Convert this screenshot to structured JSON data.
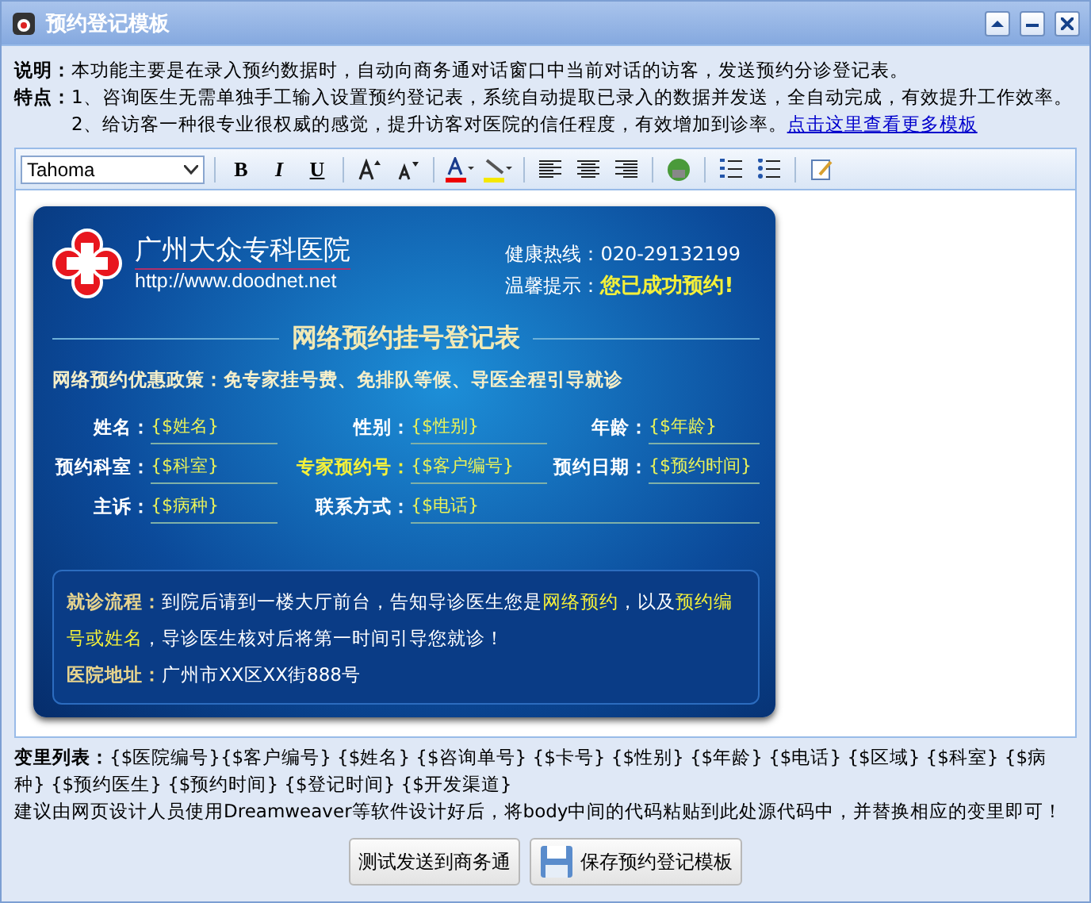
{
  "window": {
    "title": "预约登记模板"
  },
  "info": {
    "description_label": "说明：",
    "description": "本功能主要是在录入预约数据时，自动向商务通对话窗口中当前对话的访客，发送预约分诊登记表。",
    "features_label": "特点：",
    "features": [
      "1、咨询医生无需单独手工输入设置预约登记表，系统自动提取已录入的数据并发送，全自动完成，有效提升工作效率。",
      "2、给访客一种很专业很权威的感觉，提升访客对医院的信任程度，有效增加到诊率。"
    ],
    "link": "点击这里查看更多模板"
  },
  "editor": {
    "font": "Tahoma",
    "format_buttons": [
      "B",
      "I",
      "U"
    ]
  },
  "card": {
    "hospital_name": "广州大众专科医院",
    "url": "http://www.doodnet.net",
    "hotline_label": "健康热线：",
    "hotline": "020-29132199",
    "tip_label": "温馨提示：",
    "tip": "您已成功预约!",
    "form_title": "网络预约挂号登记表",
    "policy": "网络预约优惠政策：免专家挂号费、免排队等候、导医全程引导就诊",
    "fields": [
      {
        "label": "姓名：",
        "value": "{$姓名}",
        "highlight": false,
        "wide": false
      },
      {
        "label": "性别：",
        "value": "{$性别}",
        "highlight": false,
        "wide": false
      },
      {
        "label": "年龄：",
        "value": "{$年龄}",
        "highlight": false,
        "wide": false
      },
      {
        "label": "预约科室：",
        "value": "{$科室}",
        "highlight": false,
        "wide": false
      },
      {
        "label": "专家预约号：",
        "value": "{$客户编号}",
        "highlight": true,
        "wide": false
      },
      {
        "label": "预约日期：",
        "value": "{$预约时间}",
        "highlight": false,
        "wide": false
      },
      {
        "label": "主诉：",
        "value": "{$病种}",
        "highlight": false,
        "wide": false
      },
      {
        "label": "联系方式：",
        "value": "{$电话}",
        "highlight": false,
        "wide": true
      }
    ],
    "process_label": "就诊流程：",
    "process": [
      {
        "text": "到院后请到一楼大厅前台，告知导诊医生您是",
        "highlight": false
      },
      {
        "text": "网络预约",
        "highlight": true
      },
      {
        "text": "，以及",
        "highlight": false
      },
      {
        "text": "预约编号或姓名",
        "highlight": true
      },
      {
        "text": "，导诊医生核对后将第一时间引导您就诊！",
        "highlight": false
      }
    ],
    "address_label": "医院地址：",
    "address": "广州市XX区XX街888号"
  },
  "variables": {
    "label": "变里列表：",
    "list": "{$医院编号}{$客户编号} {$姓名} {$咨询单号} {$卡号} {$性别} {$年龄} {$电话} {$区域} {$科室} {$病种} {$预约医生} {$预约时间} {$登记时间} {$开发渠道}",
    "note": "建议由网页设计人员使用Dreamweaver等软件设计好后，将body中间的代码粘贴到此处源代码中，并替换相应的变里即可！"
  },
  "buttons": [
    {
      "label": "测试发送到商务通",
      "kind": "plain"
    },
    {
      "label": "保存预约登记模板",
      "kind": "save"
    }
  ]
}
